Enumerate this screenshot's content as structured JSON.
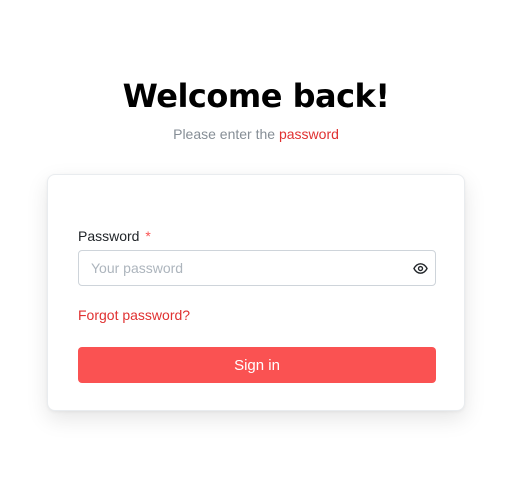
{
  "header": {
    "title": "Welcome back!",
    "subtitle_prefix": "Please enter the ",
    "subtitle_accent": "password"
  },
  "form": {
    "password_label": "Password",
    "required_marker": "*",
    "password_value": "",
    "password_placeholder": "Your password",
    "visibility_icon": "eye-icon",
    "forgot_link": "Forgot password?",
    "submit_label": "Sign in"
  },
  "colors": {
    "accent": "#fa5252",
    "link": "#e03131",
    "placeholder": "#adb5bd",
    "subtitle": "#868e96"
  }
}
